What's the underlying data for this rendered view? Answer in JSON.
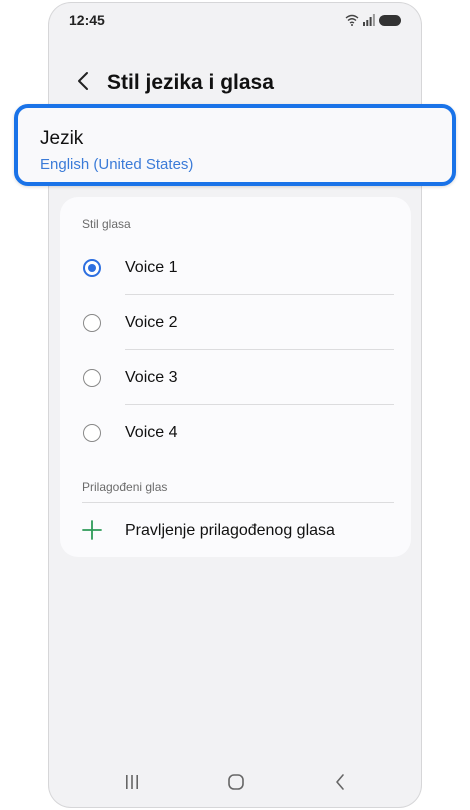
{
  "status_bar": {
    "time": "12:45"
  },
  "header": {
    "title": "Stil jezika i glasa"
  },
  "language": {
    "title": "Jezik",
    "value": "English (United States)"
  },
  "voice_section": {
    "header": "Stil glasa",
    "options": [
      {
        "label": "Voice 1",
        "selected": true
      },
      {
        "label": "Voice 2",
        "selected": false
      },
      {
        "label": "Voice 3",
        "selected": false
      },
      {
        "label": "Voice 4",
        "selected": false
      }
    ]
  },
  "custom_section": {
    "header": "Prilagođeni glas",
    "create_label": "Pravljenje prilagođenog glasa"
  },
  "colors": {
    "accent": "#1a73e8",
    "radio": "#2d6fe0",
    "plus": "#2e9b58"
  }
}
